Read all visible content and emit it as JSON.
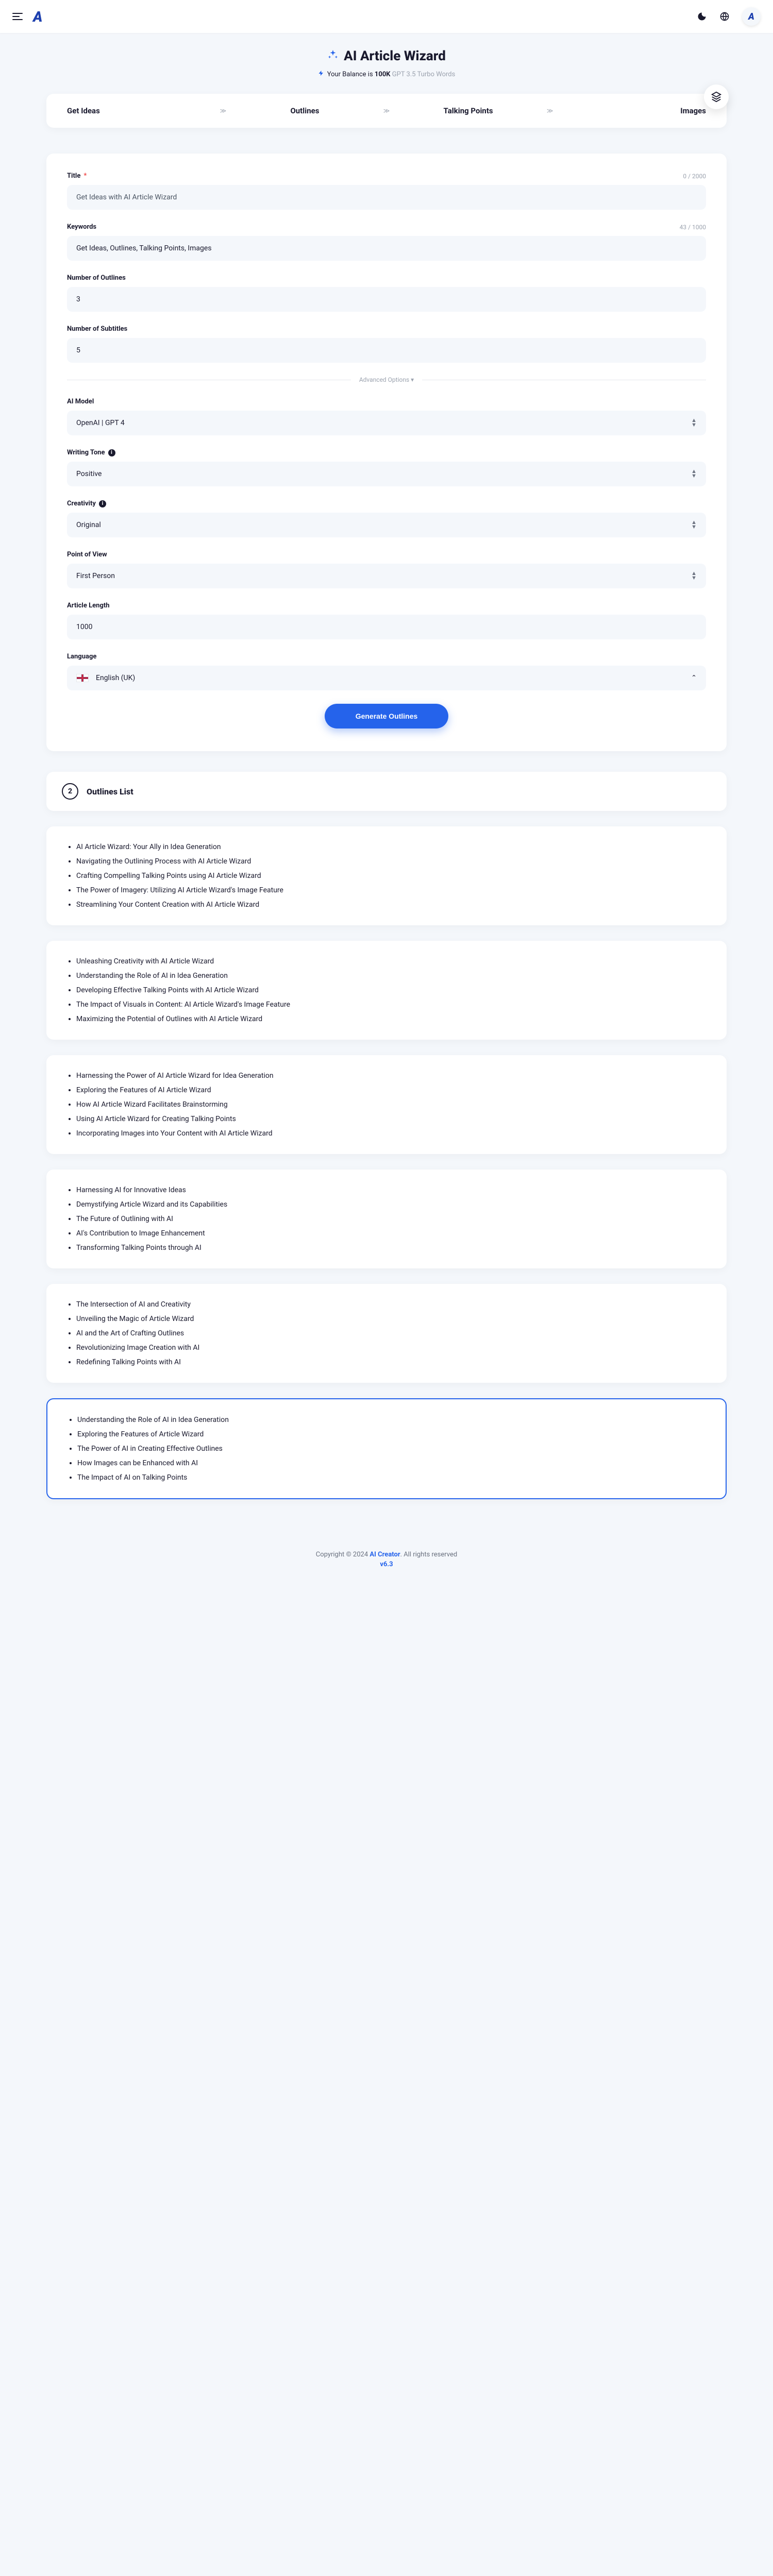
{
  "header": {
    "title": "AI Article Wizard",
    "balance_prefix": "Your Balance is ",
    "balance_value": "100K",
    "balance_suffix": " GPT 3.5 Turbo Words"
  },
  "steps": [
    "Get Ideas",
    "Outlines",
    "Talking Points",
    "Images"
  ],
  "form": {
    "title": {
      "label": "Title",
      "placeholder": "Get Ideas with AI Article Wizard",
      "value": "",
      "counter": "0 / 2000"
    },
    "keywords": {
      "label": "Keywords",
      "value": "Get Ideas, Outlines, Talking Points, Images",
      "counter": "43 / 1000"
    },
    "outlines": {
      "label": "Number of Outlines",
      "value": "3"
    },
    "subtitles": {
      "label": "Number of Subtitles",
      "value": "5"
    },
    "advanced_label": "Advanced Options ▾",
    "model": {
      "label": "AI Model",
      "value": "OpenAI | GPT 4"
    },
    "tone": {
      "label": "Writing Tone",
      "value": "Positive"
    },
    "creativity": {
      "label": "Creativity",
      "value": "Original"
    },
    "pov": {
      "label": "Point of View",
      "value": "First Person"
    },
    "length": {
      "label": "Article Length",
      "value": "1000"
    },
    "language": {
      "label": "Language",
      "value": "English (UK)"
    },
    "submit": "Generate Outlines"
  },
  "outlines_section": {
    "num": "2",
    "title": "Outlines List"
  },
  "outline_groups": [
    [
      "AI Article Wizard: Your Ally in Idea Generation",
      "Navigating the Outlining Process with AI Article Wizard",
      "Crafting Compelling Talking Points using AI Article Wizard",
      "The Power of Imagery: Utilizing AI Article Wizard's Image Feature",
      "Streamlining Your Content Creation with AI Article Wizard"
    ],
    [
      "Unleashing Creativity with AI Article Wizard",
      "Understanding the Role of AI in Idea Generation",
      "Developing Effective Talking Points with AI Article Wizard",
      "The Impact of Visuals in Content: AI Article Wizard's Image Feature",
      "Maximizing the Potential of Outlines with AI Article Wizard"
    ],
    [
      "Harnessing the Power of AI Article Wizard for Idea Generation",
      "Exploring the Features of AI Article Wizard",
      "How AI Article Wizard Facilitates Brainstorming",
      "Using AI Article Wizard for Creating Talking Points",
      "Incorporating Images into Your Content with AI Article Wizard"
    ],
    [
      "Harnessing AI for Innovative Ideas",
      "Demystifying Article Wizard and its Capabilities",
      "The Future of Outlining with AI",
      "AI's Contribution to Image Enhancement",
      "Transforming Talking Points through AI"
    ],
    [
      "The Intersection of AI and Creativity",
      "Unveiling the Magic of Article Wizard",
      "AI and the Art of Crafting Outlines",
      "Revolutionizing Image Creation with AI",
      "Redefining Talking Points with AI"
    ],
    [
      "Understanding the Role of AI in Idea Generation",
      "Exploring the Features of Article Wizard",
      "The Power of AI in Creating Effective Outlines",
      "How Images can be Enhanced with AI",
      "The Impact of AI on Talking Points"
    ]
  ],
  "selected_group": 5,
  "footer": {
    "copyright_pre": "Copyright © 2024 ",
    "brand": "AI Creator",
    "copyright_post": ". All rights reserved",
    "version": "v6.3"
  }
}
